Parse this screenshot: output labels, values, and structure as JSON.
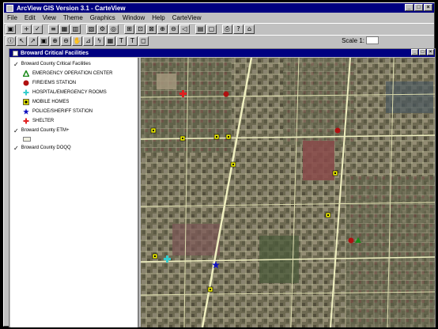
{
  "app": {
    "title": "ArcView GIS Version 3.1 - CarteView",
    "window_buttons": [
      "_",
      "□",
      "×"
    ]
  },
  "menu": [
    "File",
    "Edit",
    "View",
    "Theme",
    "Graphics",
    "Window",
    "Help",
    "CarteView"
  ],
  "toolbar": {
    "scale_label": "Scale 1:",
    "scale_value": "",
    "coord_x": "",
    "coord_y": ""
  },
  "view": {
    "title": "Broward Critical Facilities",
    "window_buttons": [
      "_",
      "□",
      "×"
    ]
  },
  "toc": {
    "themes": [
      {
        "name": "Broward County Critical Facilities",
        "checked": true
      },
      {
        "name": "Broward County ETM+",
        "checked": true
      },
      {
        "name": "Broward County DOQQ",
        "checked": true
      }
    ],
    "legend": [
      {
        "label": "EMERGENCY OPERATION CENTER",
        "icon": "triangle-green",
        "color": "#1a8a1a"
      },
      {
        "label": "FIRE/EMS STATION",
        "icon": "circle-red",
        "color": "#b01010"
      },
      {
        "label": "HOSPITAL/EMERGENCY ROOMS",
        "icon": "cross-cyan",
        "color": "#33cccc"
      },
      {
        "label": "MOBILE HOMES",
        "icon": "square-yellow",
        "color": "#e8e800"
      },
      {
        "label": "POLICE/SHERIFF STATION",
        "icon": "star-blue",
        "color": "#1010c0"
      },
      {
        "label": "SHELTER",
        "icon": "cross-red",
        "color": "#e02020"
      }
    ]
  }
}
